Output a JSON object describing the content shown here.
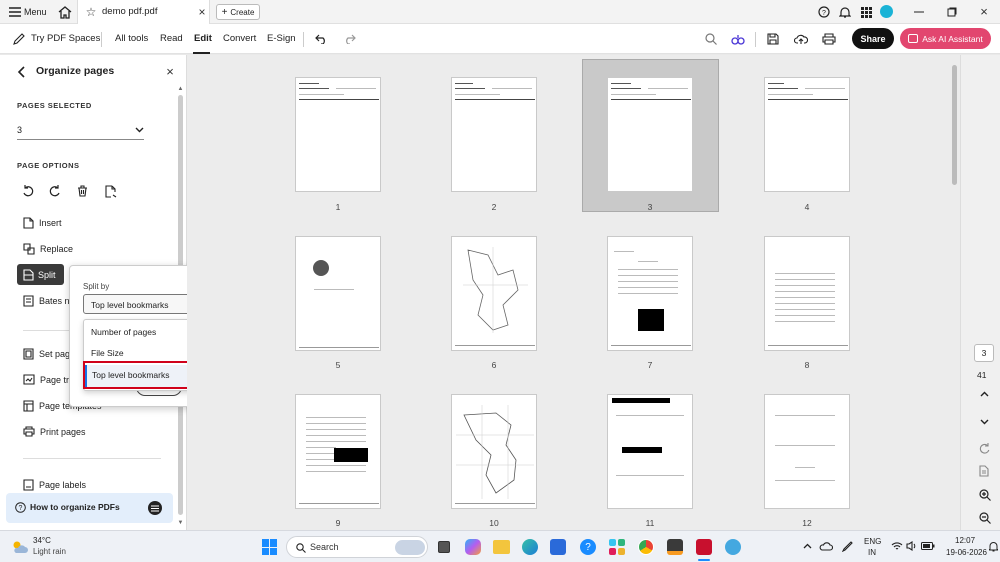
{
  "titlebar": {
    "menu_label": "Menu",
    "tab_title": "demo pdf.pdf",
    "create_label": "Create"
  },
  "toolbar": {
    "spaces_label": "Try PDF Spaces",
    "items": [
      "All tools",
      "Read",
      "Edit",
      "Convert",
      "E-Sign"
    ],
    "active_item": "Edit",
    "share_label": "Share",
    "ai_label": "Ask AI Assistant"
  },
  "panel": {
    "title": "Organize pages",
    "pages_selected_heading": "PAGES SELECTED",
    "pages_selected_value": "3",
    "page_options_heading": "PAGE OPTIONS",
    "options": [
      "Insert",
      "Replace",
      "Split",
      "Bates nu",
      "Set page",
      "Page tra",
      "Page templates",
      "Print pages"
    ],
    "page_labels": "Page labels",
    "help_label": "How to organize PDFs"
  },
  "split_popup": {
    "label": "Split by",
    "selected": "Top level bookmarks",
    "options": [
      "Number of pages",
      "File Size",
      "Top level bookmarks"
    ]
  },
  "pages": [
    "1",
    "2",
    "3",
    "4",
    "5",
    "6",
    "7",
    "8",
    "9",
    "10",
    "11",
    "12"
  ],
  "selected_page": "3",
  "rightrail": {
    "current_page": "3",
    "total_pages": "41"
  },
  "taskbar": {
    "temp": "34°C",
    "weather": "Light rain",
    "search_placeholder": "Search",
    "lang1": "ENG",
    "lang2": "IN",
    "time": "12:07",
    "date": "19-06-2026"
  },
  "colors": {
    "accent_blue": "#1473e6",
    "share_bg": "#111111",
    "ai_bg": "#e2466f",
    "highlight_red": "#d0021b"
  }
}
